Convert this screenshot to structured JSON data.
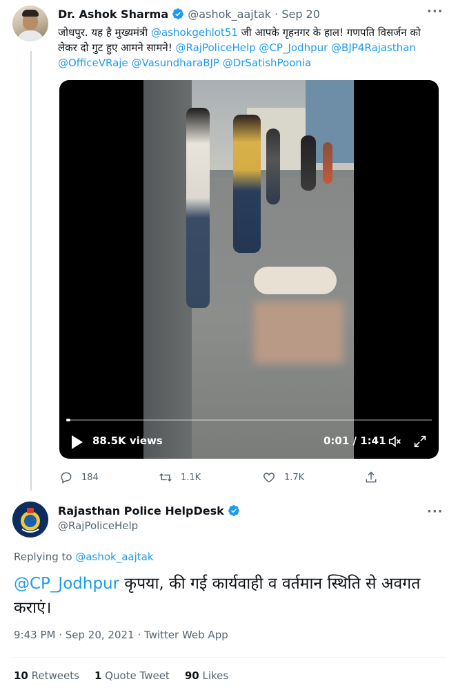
{
  "tweet1": {
    "author_name": "Dr. Ashok Sharma",
    "handle": "@ashok_aajtak",
    "separator": "·",
    "date": "Sep 20",
    "text_line1_pre": "जोधपुर. यह है मुख्यमंत्री ",
    "text_mention1": "@ashokgehlot51",
    "text_line1_post": " जी आपके गृहनगर के हाल! गणपति विसर्जन को",
    "text_line2_pre": "लेकर दो गुट हुए आमने सामने! ",
    "text_mentions2": "@RajPoliceHelp @CP_Jodhpur @BJP4Rajasthan",
    "text_mentions3": "@OfficeVRaje @VasundharaBJP @DrSatishPoonia",
    "more_icon": "···",
    "video": {
      "views": "88.5K views",
      "time": "0:01 / 1:41",
      "progress_fraction": 0.01
    },
    "actions": {
      "replies": "184",
      "retweets": "1.1K",
      "likes": "1.7K"
    }
  },
  "tweet2": {
    "author_name": "Rajasthan Police HelpDesk",
    "handle": "@RajPoliceHelp",
    "more_icon": "···",
    "replying_prefix": "Replying to ",
    "replying_to": "@ashok_aajtak",
    "mention": "@CP_Jodhpur",
    "text": " कृपया, की गई कार्यवाही व वर्तमान स्थिति से अवगत कराएं।",
    "time": "9:43 PM",
    "date": "Sep 20, 2021",
    "source": "Twitter Web App",
    "meta_sep": " · ",
    "stats": {
      "retweets_count": "10",
      "retweets_label": "Retweets",
      "quotes_count": "1",
      "quotes_label": "Quote Tweet",
      "likes_count": "90",
      "likes_label": "Likes"
    }
  },
  "colors": {
    "accent": "#1d9bf0",
    "text": "#0f1419",
    "secondary": "#536471"
  }
}
